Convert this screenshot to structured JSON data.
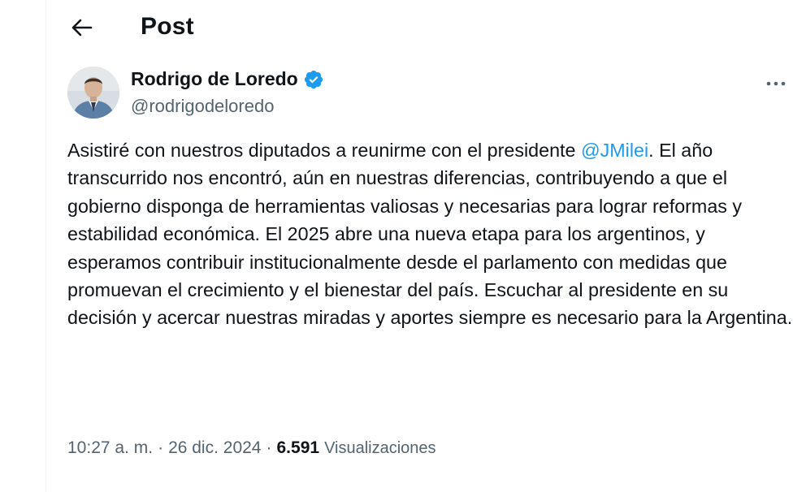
{
  "header": {
    "title": "Post",
    "back_icon": "arrow-left-icon"
  },
  "author": {
    "display_name": "Rodrigo de Loredo",
    "handle": "@rodrigodeloredo",
    "verified_color": "#1d9bf0",
    "avatar_icon": "profile-photo"
  },
  "tweet": {
    "text_before": "Asistiré con nuestros diputados a reunirme con el presidente ",
    "mention": "@JMilei",
    "text_after": ". El año transcurrido nos encontró, aún en nuestras diferencias, contribuyendo a que el gobierno disponga de herramientas valiosas y necesarias para lograr reformas y estabilidad económica. El 2025 abre una nueva etapa para los argentinos, y esperamos contribuir institucionalmente desde el parlamento con medidas que promuevan el crecimiento y el bienestar del país. Escuchar al presidente en su decisión y acercar nuestras miradas y aportes siempre es necesario para la Argentina."
  },
  "meta": {
    "time": "10:27 a. m.",
    "separator": "·",
    "date": "26 dic. 2024",
    "views_count": "6.591",
    "views_label": "Visualizaciones"
  },
  "colors": {
    "text": "#0f1419",
    "secondary": "#536471",
    "accent": "#1d9bf0"
  }
}
